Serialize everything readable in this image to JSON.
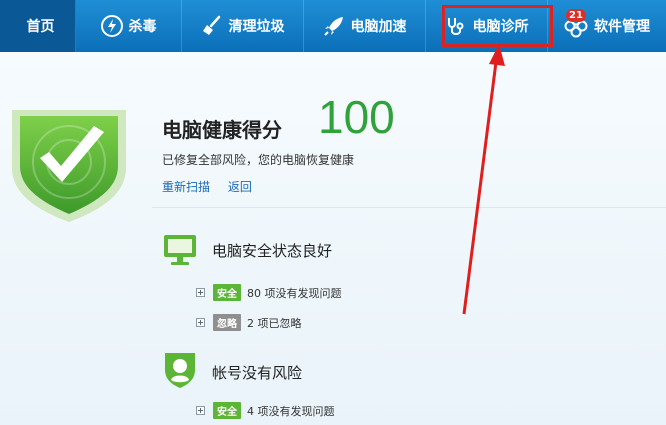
{
  "nav": {
    "home": "首页",
    "antivirus": "杀毒",
    "cleanup": "清理垃圾",
    "speedup": "电脑加速",
    "clinic": "电脑诊所",
    "software": "软件管理",
    "software_badge": "21"
  },
  "score": {
    "title": "电脑健康得分",
    "value": "100",
    "description": "已修复全部风险，您的电脑恢复健康"
  },
  "links": {
    "rescan": "重新扫描",
    "back": "返回"
  },
  "sections": [
    {
      "title": "电脑安全状态良好",
      "rows": [
        {
          "tag": "安全",
          "text": "80 项没有发现问题"
        },
        {
          "tag": "忽略",
          "text": "2 项已忽略"
        }
      ]
    },
    {
      "title": "帐号没有风险",
      "rows": [
        {
          "tag": "安全",
          "text": "4 项没有发现问题"
        }
      ]
    }
  ],
  "colors": {
    "nav_blue": "#0b6fb8",
    "score_green": "#2fa23a",
    "safe_tag": "#5cb536",
    "ignore_tag": "#8f8f8f",
    "annotation_red": "#d92424"
  },
  "icons": {
    "home": "home-icon",
    "antivirus": "lightning-shield-icon",
    "cleanup": "broom-icon",
    "speedup": "rocket-icon",
    "clinic": "stethoscope-icon",
    "software": "clover-icon"
  }
}
